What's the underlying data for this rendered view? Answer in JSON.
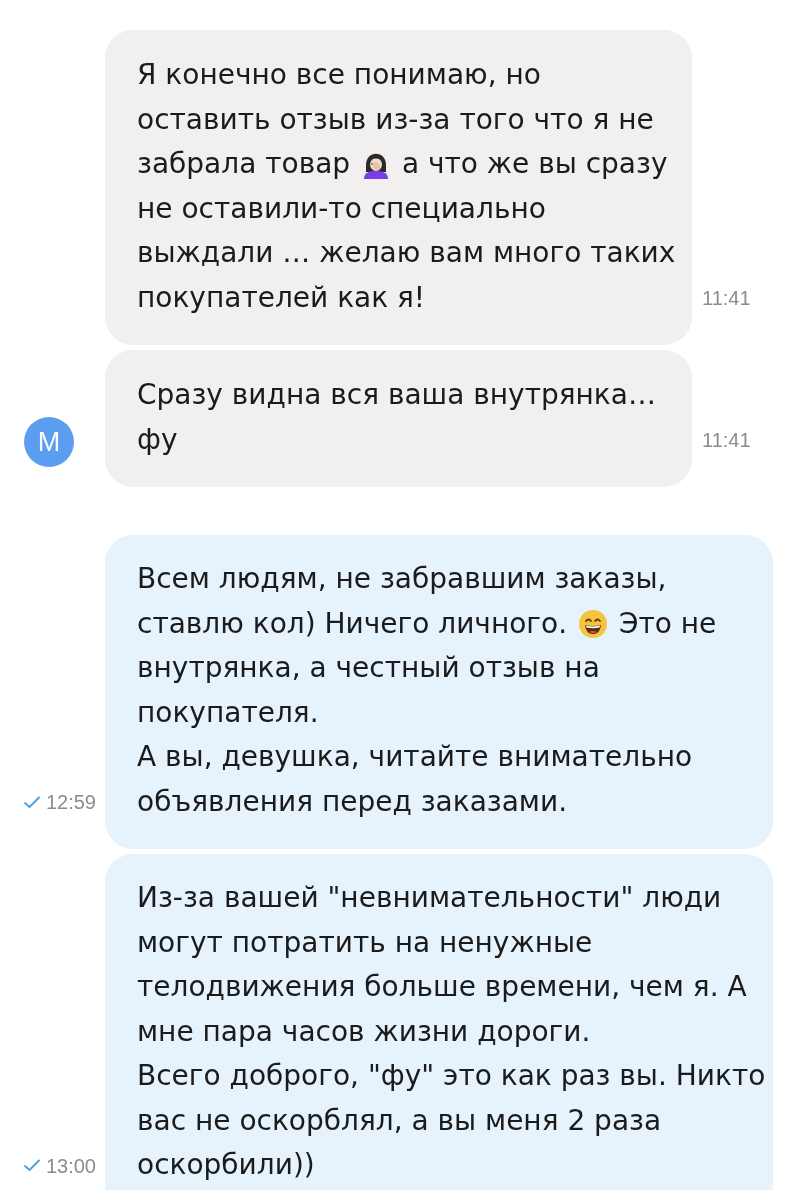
{
  "messages": [
    {
      "kind": "incoming",
      "time": "11:41",
      "parts": [
        {
          "kind": "text",
          "text": "Я конечно все понимаю, но оставить отзыв из-за того что я не забрала товар"
        },
        {
          "kind": "facepalm"
        },
        {
          "kind": "text",
          "text": "а что же вы сразу не оставили-то специально выждали … желаю вам много таких покупателей как я!"
        }
      ]
    },
    {
      "kind": "incoming",
      "time": "11:41",
      "avatar": {
        "letter": "М"
      },
      "parts": [
        {
          "kind": "text",
          "text": "Сразу видна вся ваша внутрянка… фу"
        }
      ]
    },
    {
      "kind": "outgoing",
      "time": "12:59",
      "read": false,
      "parts": [
        {
          "kind": "text",
          "text": "Всем людям, не забравшим заказы, ставлю кол) Ничего личного."
        },
        {
          "kind": "grin"
        },
        {
          "kind": "text",
          "text": "Это не внутрянка, а честный отзыв на покупателя.\nА вы, девушка, читайте внимательно объявления перед заказами."
        }
      ]
    },
    {
      "kind": "outgoing",
      "time": "13:00",
      "read": false,
      "parts": [
        {
          "kind": "text",
          "text": "Из-за вашей \"невнимательности\" люди могут потратить на ненужные телодвижения больше времени, чем я. А мне пара часов жизни дороги.\nВсего доброго, \"фу\" это как раз вы. Никто вас не оскорблял, а вы меня 2 раза оскорбили))"
        }
      ]
    }
  ]
}
